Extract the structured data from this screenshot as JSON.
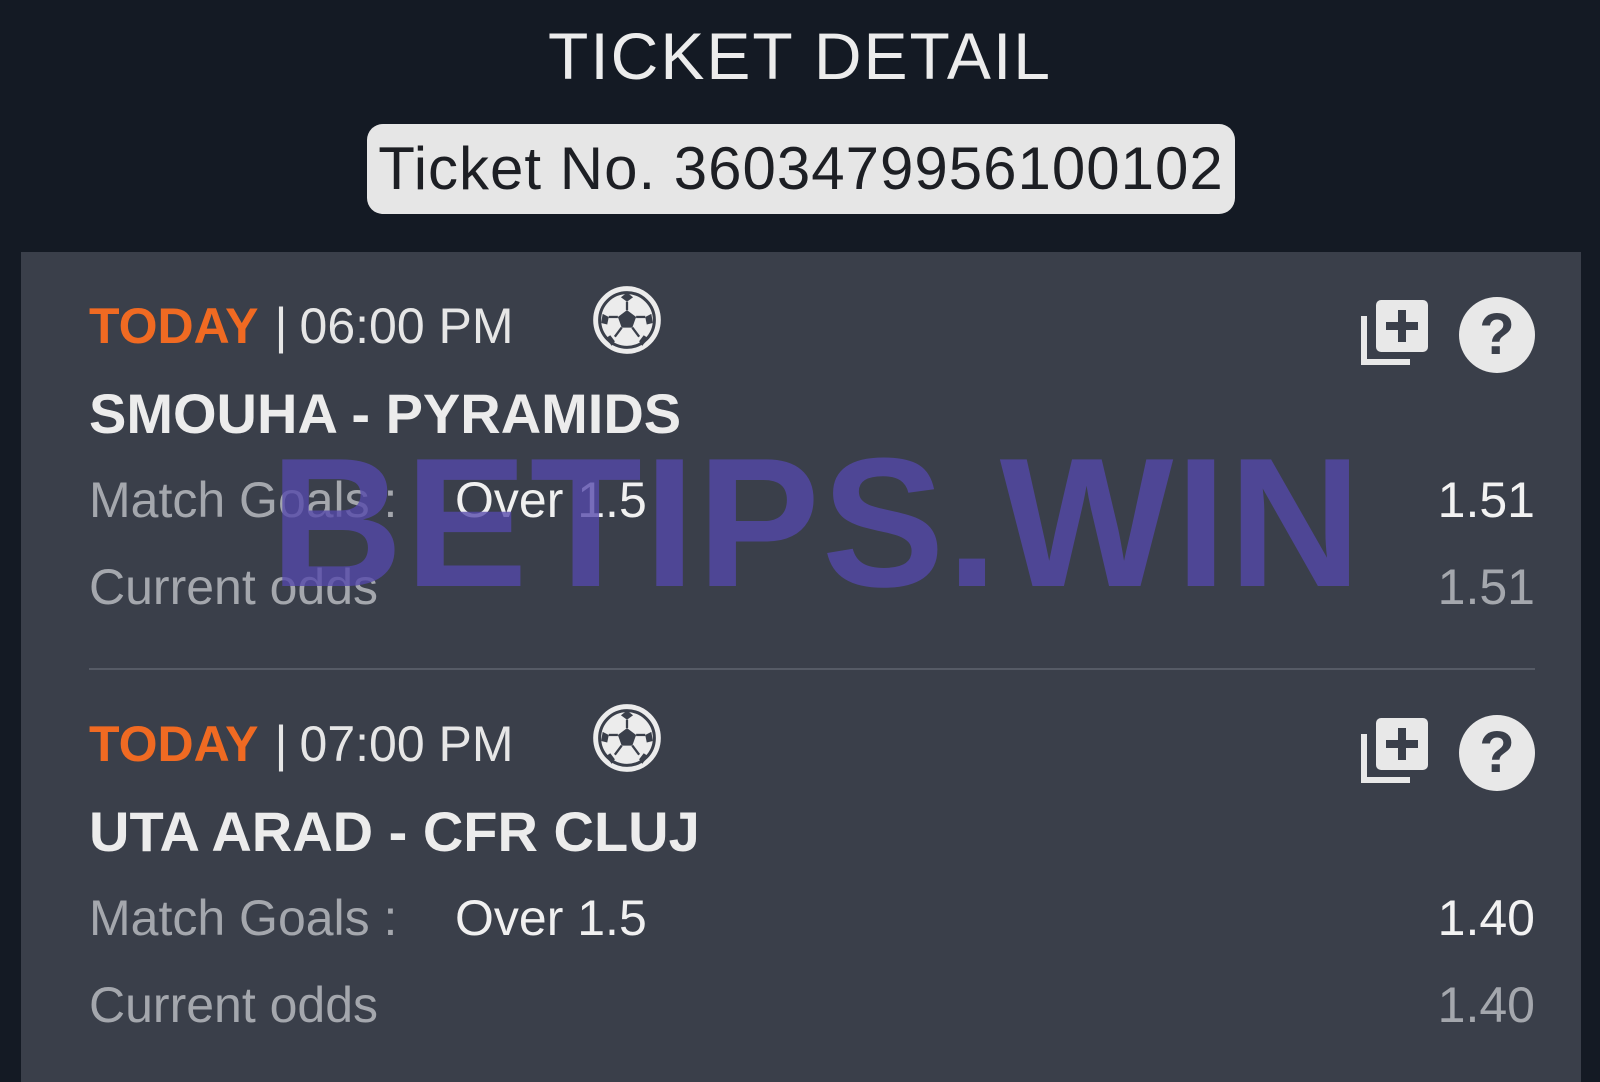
{
  "header": {
    "title": "TICKET DETAIL",
    "ticket_number": "Ticket No. 3603479956100102"
  },
  "matches": [
    {
      "day": "TODAY",
      "separator": "|",
      "time": "06:00 PM",
      "sport_icon": "soccer-ball-icon",
      "teams": "SMOUHA - PYRAMIDS",
      "market_label": "Match Goals :",
      "market_value": "Over 1.5",
      "odd": "1.51",
      "current_odds_label": "Current odds",
      "current_odd": "1.51"
    },
    {
      "day": "TODAY",
      "separator": "|",
      "time": "07:00 PM",
      "sport_icon": "soccer-ball-icon",
      "teams": "UTA ARAD - CFR CLUJ",
      "market_label": "Match Goals :",
      "market_value": "Over 1.5",
      "odd": "1.40",
      "current_odds_label": "Current odds",
      "current_odd": "1.40"
    }
  ],
  "icons": {
    "add": "add-to-betslip-icon",
    "help": "help-icon"
  },
  "help_glyph": "?",
  "watermark": "BETIPS.WIN",
  "colors": {
    "background": "#141a24",
    "card": "#3a3f4a",
    "accent": "#f06a22",
    "ticket_badge": "#e6e6e6",
    "watermark": "#5448aa"
  }
}
